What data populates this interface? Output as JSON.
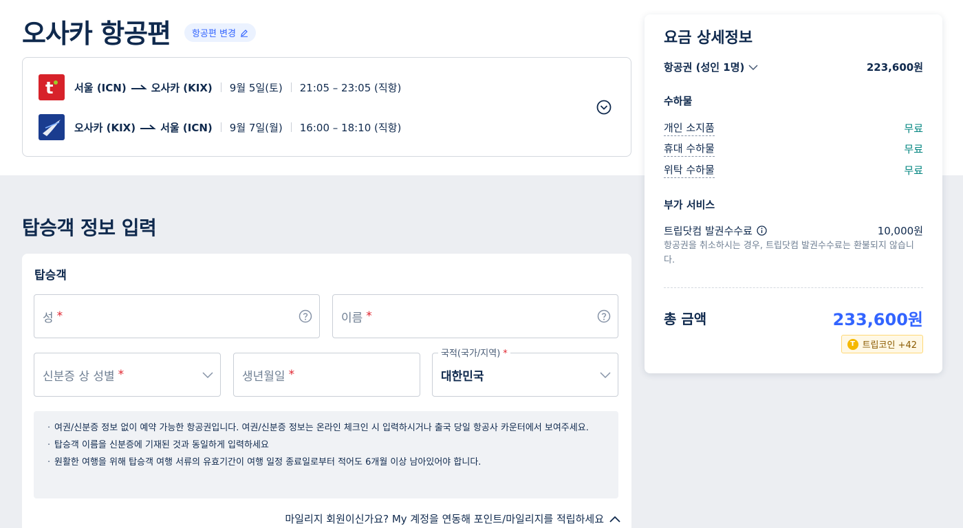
{
  "header": {
    "title": "오사카 항공편",
    "change_label": "항공편 변경"
  },
  "flights": [
    {
      "airline_icon": "tway-logo-icon",
      "route_from": "서울 (ICN)",
      "route_to": "오사카 (KIX)",
      "date": "9월 5일(토)",
      "time": "21:05 – 23:05 (직항)"
    },
    {
      "airline_icon": "jeju-logo-icon",
      "route_from": "오사카 (KIX)",
      "route_to": "서울 (ICN)",
      "date": "9월 7일(월)",
      "time": "16:00 – 18:10 (직항)"
    }
  ],
  "passenger_section": {
    "title": "탑승객 정보 입력",
    "card_label": "탑승객",
    "last_name_label": "성",
    "first_name_label": "이름",
    "gender_label": "신분증 상 성별",
    "birth_label": "생년월일",
    "nationality_label": "국적(국가/지역)",
    "nationality_value": "대한민국",
    "required_mark": "*",
    "notices": [
      "여권/신분증 정보 없이 예약 가능한 항공권입니다. 여권/신분증 정보는 온라인 체크인 시 입력하시거나 출국 당일 항공사 카운터에서 보여주세요.",
      "탑승객 이름을 신분증에 기재된 것과 동일하게 입력하세요",
      "원활한 여행을 위해 탑승객 여행 서류의 유효기간이 여행 일정 종료일로부터 적어도 6개월 이상 남아있어야 합니다."
    ],
    "mileage_prompt": "마일리지 회원이신가요? My 계정을 연동해 포인트/마일리지를 적립하세요"
  },
  "price": {
    "title": "요금 상세정보",
    "ticket_label": "항공권 (성인 1명)",
    "ticket_value": "223,600원",
    "baggage_title": "수하물",
    "baggage": [
      {
        "label": "개인 소지품",
        "value": "무료"
      },
      {
        "label": "휴대 수하물",
        "value": "무료"
      },
      {
        "label": "위탁 수하물",
        "value": "무료"
      }
    ],
    "extra_title": "부가 서비스",
    "fee_label": "트립닷컴 발권수수료",
    "fee_value": "10,000원",
    "fee_note": "항공권을 취소하시는 경우, 트립닷컴 발권수수료는 환불되지 않습니다.",
    "total_label": "총 금액",
    "total_value": "233,600원",
    "coin_label": "트립코인 +42"
  },
  "colors": {
    "accent": "#3264ff",
    "free": "#00847f",
    "required": "#e0242e"
  }
}
